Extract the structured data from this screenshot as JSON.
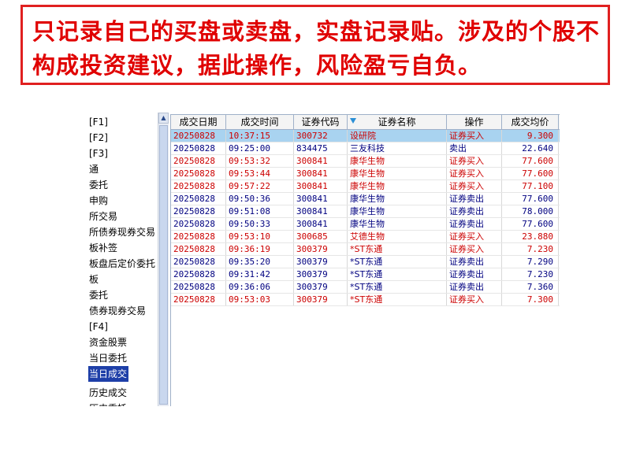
{
  "banner": {
    "text": "只记录自己的买盘或卖盘，实盘记录贴。涉及的个股不构成投资建议，据此操作，风险盈亏自负。"
  },
  "sidebar": {
    "items": [
      {
        "label": "[F1]"
      },
      {
        "label": "[F2]"
      },
      {
        "label": "[F3]"
      },
      {
        "label": "通"
      },
      {
        "label": "委托"
      },
      {
        "label": "申购"
      },
      {
        "label": "所交易"
      },
      {
        "label": "所债券现券交易"
      },
      {
        "label": "板补签"
      },
      {
        "label": "板盘后定价委托"
      },
      {
        "label": "板"
      },
      {
        "label": "委托"
      },
      {
        "label": "债券现券交易"
      },
      {
        "label": "[F4]"
      },
      {
        "label": "资金股票"
      },
      {
        "label": "当日委托"
      },
      {
        "label": "当日成交",
        "selected": true
      },
      {
        "label": "历史成交"
      },
      {
        "label": "历史委托"
      }
    ]
  },
  "table": {
    "columns": [
      "成交日期",
      "成交时间",
      "证券代码",
      "证券名称",
      "操作",
      "成交均价"
    ],
    "sort_column_index": 3,
    "rows": [
      {
        "date": "20250828",
        "time": "10:37:15",
        "code": "300732",
        "name": "设研院",
        "op": "证券买入",
        "price": "9.300",
        "color": "red",
        "selected": true
      },
      {
        "date": "20250828",
        "time": "09:25:00",
        "code": "834475",
        "name": "三友科技",
        "op": "卖出",
        "price": "22.640",
        "color": "blue"
      },
      {
        "date": "20250828",
        "time": "09:53:32",
        "code": "300841",
        "name": "康华生物",
        "op": "证券买入",
        "price": "77.600",
        "color": "red"
      },
      {
        "date": "20250828",
        "time": "09:53:44",
        "code": "300841",
        "name": "康华生物",
        "op": "证券买入",
        "price": "77.600",
        "color": "red"
      },
      {
        "date": "20250828",
        "time": "09:57:22",
        "code": "300841",
        "name": "康华生物",
        "op": "证券买入",
        "price": "77.100",
        "color": "red"
      },
      {
        "date": "20250828",
        "time": "09:50:36",
        "code": "300841",
        "name": "康华生物",
        "op": "证券卖出",
        "price": "77.600",
        "color": "blue"
      },
      {
        "date": "20250828",
        "time": "09:51:08",
        "code": "300841",
        "name": "康华生物",
        "op": "证券卖出",
        "price": "78.000",
        "color": "blue"
      },
      {
        "date": "20250828",
        "time": "09:50:33",
        "code": "300841",
        "name": "康华生物",
        "op": "证券卖出",
        "price": "77.600",
        "color": "blue"
      },
      {
        "date": "20250828",
        "time": "09:53:10",
        "code": "300685",
        "name": "艾德生物",
        "op": "证券买入",
        "price": "23.880",
        "color": "red"
      },
      {
        "date": "20250828",
        "time": "09:36:19",
        "code": "300379",
        "name": "*ST东通",
        "op": "证券买入",
        "price": "7.230",
        "color": "red"
      },
      {
        "date": "20250828",
        "time": "09:35:20",
        "code": "300379",
        "name": "*ST东通",
        "op": "证券卖出",
        "price": "7.290",
        "color": "blue"
      },
      {
        "date": "20250828",
        "time": "09:31:42",
        "code": "300379",
        "name": "*ST东通",
        "op": "证券卖出",
        "price": "7.230",
        "color": "blue"
      },
      {
        "date": "20250828",
        "time": "09:36:06",
        "code": "300379",
        "name": "*ST东通",
        "op": "证券卖出",
        "price": "7.360",
        "color": "blue"
      },
      {
        "date": "20250828",
        "time": "09:53:03",
        "code": "300379",
        "name": "*ST东通",
        "op": "证券买入",
        "price": "7.300",
        "color": "red"
      }
    ]
  },
  "colors": {
    "buy": "#cc0000",
    "sell": "#000080",
    "selected_row": "#a9d3f0",
    "banner_red": "#e00000"
  }
}
